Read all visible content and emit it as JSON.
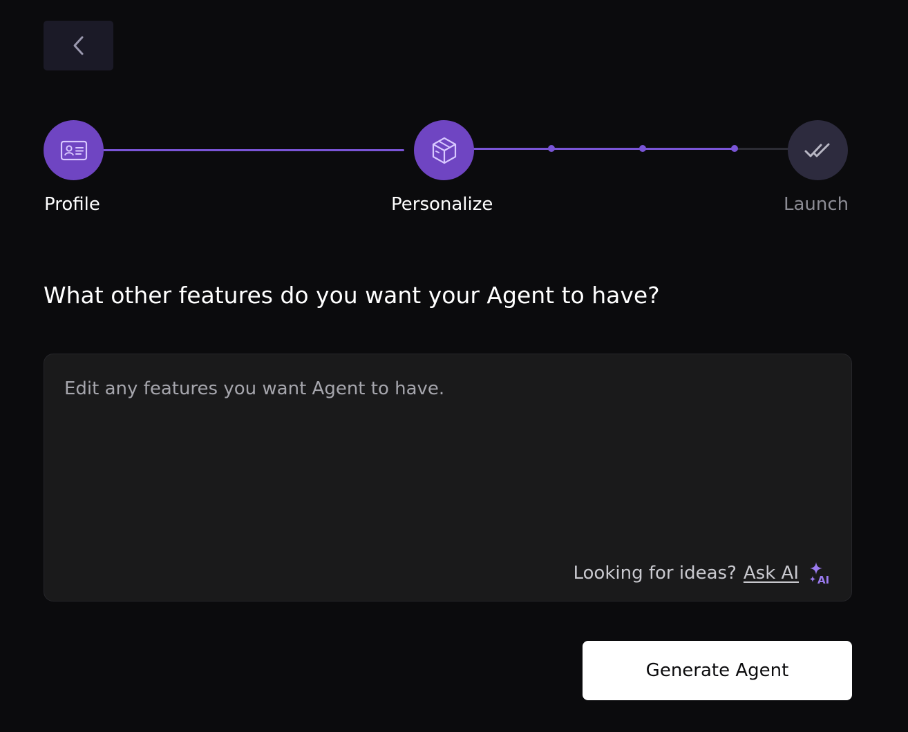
{
  "back": {
    "icon": "chevron-left-icon"
  },
  "stepper": {
    "steps": [
      {
        "label": "Profile",
        "icon": "id-card-icon",
        "state": "complete"
      },
      {
        "label": "Personalize",
        "icon": "box-icon",
        "state": "current"
      },
      {
        "label": "Launch",
        "icon": "double-check-icon",
        "state": "pending"
      }
    ],
    "substeps_completed": 3
  },
  "question": "What other features do you want your Agent to have?",
  "features": {
    "value": "",
    "placeholder": "Edit any features you want Agent to have.",
    "ideas_prompt": "Looking for ideas?",
    "ask_ai_label": "Ask AI",
    "ai_icon": "sparkle-ai-icon"
  },
  "actions": {
    "generate_label": "Generate Agent"
  },
  "colors": {
    "background": "#0b0b0d",
    "accent": "#6f45c2",
    "accent_line": "#7a55d6",
    "inactive_step": "#2d2b3e",
    "input_bg": "#1a1a1b",
    "button_bg": "#ffffff"
  }
}
